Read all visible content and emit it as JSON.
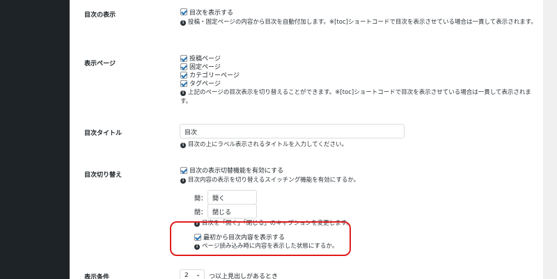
{
  "rows": {
    "toc_display": {
      "label": "目次の表示",
      "checkbox_label": "目次を表示する",
      "desc": "投稿・固定ページの内容から目次を自動付加します。※[toc]ショートコードで目次を表示させている場合は一貫して表示されます。"
    },
    "display_pages": {
      "label": "表示ページ",
      "options": [
        "投稿ページ",
        "固定ページ",
        "カテゴリーページ",
        "タグページ"
      ],
      "desc_line1": "上記のページの目次表示を切り替えることができます。※[toc]ショートコードで目次を表示させている場合は一貫して表示されま",
      "desc_line2": "す。"
    },
    "toc_title": {
      "label": "目次タイトル",
      "value": "目次",
      "desc": "目次の上にラベル表示されるタイトルを入力してください。"
    },
    "toc_toggle": {
      "label": "目次切り替え",
      "checkbox_label": "目次の表示切替機能を有効にする",
      "desc": "目次内容の表示を切り替えるスイッチング機能を有効にするか。",
      "open_label": "開：",
      "open_value": "開く",
      "close_label": "閉：",
      "close_value": "閉じる",
      "caption_desc": "目次を「開く」「閉じる」のキャプションを変更します。",
      "initial_checkbox_label": "最初から目次内容を表示する",
      "initial_desc": "ページ読み込み時に内容を表示した状態にするか。"
    },
    "display_condition": {
      "label": "表示条件",
      "select_value": "2",
      "suffix": "つ以上見出しがあるとき"
    }
  }
}
